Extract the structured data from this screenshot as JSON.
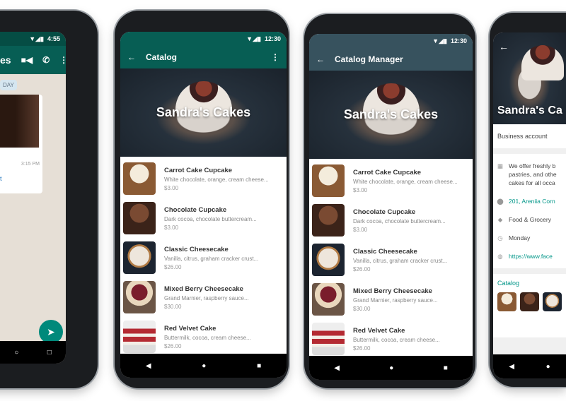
{
  "phone1": {
    "time": "4:55",
    "chat_name": "es",
    "date_chip": "DAY",
    "msg_time": "3:15 PM",
    "link_fragment": "t",
    "color": "#075e54"
  },
  "catalog_items": [
    {
      "name": "Carrot Cake Cupcake",
      "desc": "White chocolate, orange, cream cheese...",
      "price": "$3.00"
    },
    {
      "name": "Chocolate Cupcake",
      "desc": "Dark cocoa, chocolate buttercream...",
      "price": "$3.00"
    },
    {
      "name": "Classic Cheesecake",
      "desc": "Vanilla, citrus, graham cracker crust...",
      "price": "$26.00"
    },
    {
      "name": "Mixed Berry Cheesecake",
      "desc": "Grand Marnier, raspberry sauce...",
      "price": "$30.00"
    },
    {
      "name": "Red Velvet Cake",
      "desc": "Buttermilk, cocoa, cream cheese...",
      "price": "$26.00"
    }
  ],
  "phone2": {
    "time": "12:30",
    "title": "Catalog",
    "hero_title": "Sandra's Cakes",
    "color": "#075e54"
  },
  "phone3": {
    "time": "12:30",
    "title": "Catalog Manager",
    "hero_title": "Sandra's Cakes",
    "color": "#37525e"
  },
  "phone4": {
    "hero_title": "Sandra's Ca",
    "account_type": "Business account",
    "description": [
      "We offer freshly b",
      "pastries, and othe",
      "cakes for all occa"
    ],
    "address": "201, Areniia Corn",
    "category": "Food & Grocery",
    "hours": "Monday",
    "website": "https://www.face",
    "catalog_label": "Catalog",
    "link_color": "#009688"
  }
}
